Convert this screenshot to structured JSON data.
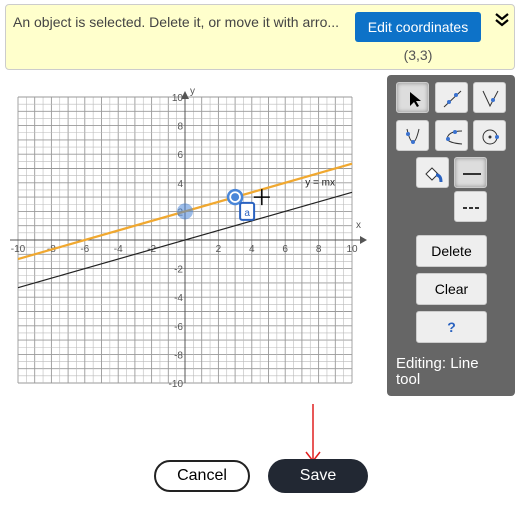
{
  "banner": {
    "message": "An object is selected. Delete it, or move it with arro...",
    "edit_label": "Edit coordinates",
    "coordinates": "(3,3)",
    "collapse_icon": "double-chevron-down-icon"
  },
  "graph": {
    "xlabel": "x",
    "ylabel": "y",
    "xlim": [
      -10,
      10
    ],
    "ylim": [
      -10,
      10
    ],
    "xticks": [
      "-10",
      "-8",
      "-6",
      "-4",
      "-2",
      "2",
      "4",
      "6",
      "8",
      "10"
    ],
    "yticks": [
      "10",
      "8",
      "6",
      "4",
      "2",
      "-2",
      "-4",
      "-6",
      "-8",
      "-10"
    ],
    "lines": [
      {
        "equation": "y = x/3 + 2",
        "color": "#f0a830",
        "points": [
          [
            0,
            2
          ],
          [
            3,
            3
          ]
        ]
      },
      {
        "equation": "y = x/3",
        "color": "#222222",
        "label": "y = mx"
      }
    ],
    "point_label": "a",
    "accent": "#4a86d8"
  },
  "toolbar": {
    "tools": [
      "select-tool",
      "line-tool",
      "ray-tool",
      "parabola-tool",
      "hyperbola-tool",
      "circle-tool"
    ],
    "delete_label": "Delete",
    "clear_label": "Clear",
    "help_label": "?",
    "editing": "Editing: Line tool"
  },
  "footer": {
    "cancel_label": "Cancel",
    "save_label": "Save"
  }
}
